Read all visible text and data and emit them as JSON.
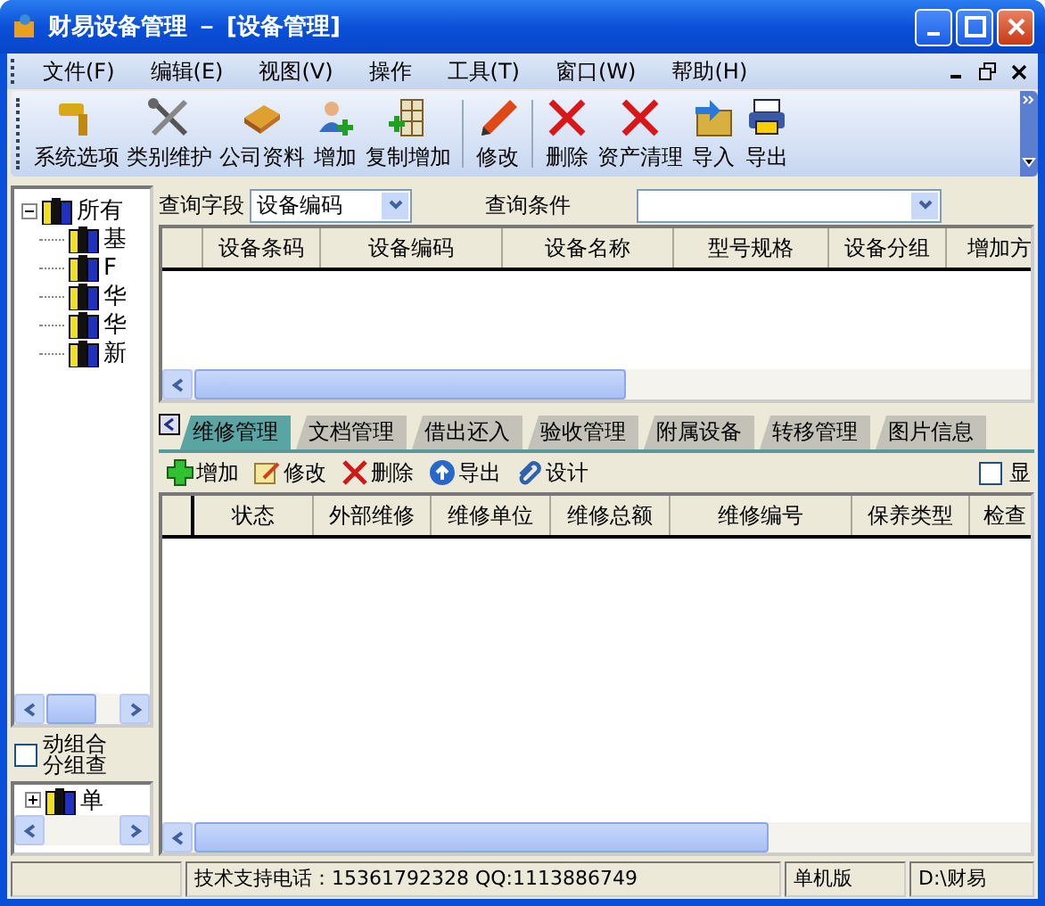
{
  "window": {
    "title": "财易设备管理 － [设备管理]"
  },
  "menu": [
    "文件(F)",
    "编辑(E)",
    "视图(V)",
    "操作",
    "工具(T)",
    "窗口(W)",
    "帮助(H)"
  ],
  "toolbar": [
    {
      "kind": "button",
      "label": "系统选项"
    },
    {
      "kind": "button",
      "label": "类别维护"
    },
    {
      "kind": "button",
      "label": "公司资料"
    },
    {
      "kind": "button",
      "label": "增加"
    },
    {
      "kind": "button",
      "label": "复制增加"
    },
    {
      "kind": "separator"
    },
    {
      "kind": "button",
      "label": "修改"
    },
    {
      "kind": "separator"
    },
    {
      "kind": "button",
      "label": "删除"
    },
    {
      "kind": "button",
      "label": "资产清理"
    },
    {
      "kind": "button",
      "label": "导入"
    },
    {
      "kind": "button",
      "label": "导出"
    }
  ],
  "sidebar": {
    "tree": {
      "label": "所有",
      "expanded": true,
      "children": [
        {
          "label": "基"
        },
        {
          "label": "F"
        },
        {
          "label": "华"
        },
        {
          "label": "华"
        },
        {
          "label": "新"
        }
      ]
    },
    "options": [
      {
        "lines": [
          "动组合",
          "分组查"
        ],
        "checked": false
      }
    ],
    "lower_tree": {
      "label": "单",
      "expanded": false
    }
  },
  "query": {
    "field_label": "查询字段",
    "field_value": "设备编码",
    "condition_label": "查询条件"
  },
  "table": {
    "columns": [
      "设备条码",
      "设备编码",
      "设备名称",
      "型号规格",
      "设备分组",
      "增加方"
    ]
  },
  "tabs": [
    {
      "label": "维修管理",
      "selected": true
    },
    {
      "label": "文档管理",
      "selected": false
    },
    {
      "label": "借出还入",
      "selected": false
    },
    {
      "label": "验收管理",
      "selected": false
    },
    {
      "label": "附属设备",
      "selected": false
    },
    {
      "label": "转移管理",
      "selected": false
    },
    {
      "label": "图片信息",
      "selected": false
    }
  ],
  "sub_toolbar": {
    "buttons": [
      "增加",
      "修改",
      "删除",
      "导出",
      "设计"
    ],
    "show_option": {
      "label": "显",
      "checked": false
    }
  },
  "sub_table": {
    "columns": [
      "状态",
      "外部维修",
      "维修单位",
      "维修总额",
      "维修编号",
      "保养类型",
      "检查"
    ]
  },
  "status_bar": [
    "技术支持电话：15361792328 QQ:1113886749",
    "单机版",
    "D:\\财易"
  ]
}
